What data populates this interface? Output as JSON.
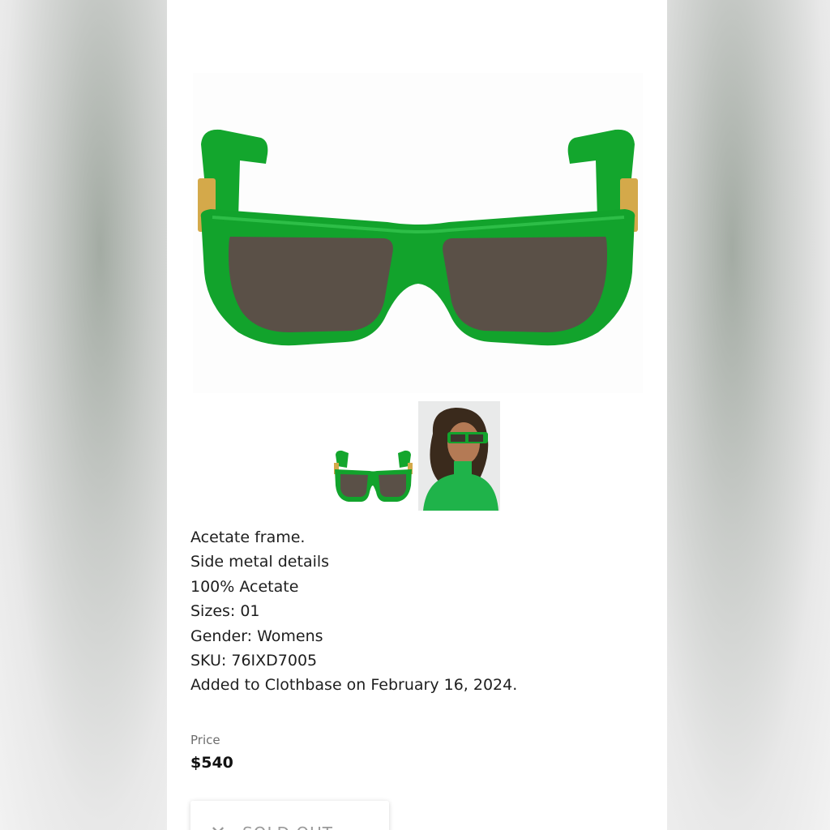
{
  "product": {
    "images": {
      "main_alt": "Green acetate sunglasses",
      "thumbnails": [
        "sunglasses-front",
        "model-wearing"
      ]
    },
    "details": [
      "Acetate frame.",
      "Side metal details",
      "100% Acetate",
      "Sizes: 01",
      "Gender: Womens",
      "SKU: 76IXD7005",
      "Added to Clothbase on February 16, 2024."
    ],
    "price_label": "Price",
    "price": "$540",
    "status_button": {
      "icon": "close-icon",
      "label": "SOLD OUT"
    }
  },
  "colors": {
    "frame_green": "#12a32c",
    "lens": "#5a5047",
    "hardware_gold": "#d4a94a"
  }
}
